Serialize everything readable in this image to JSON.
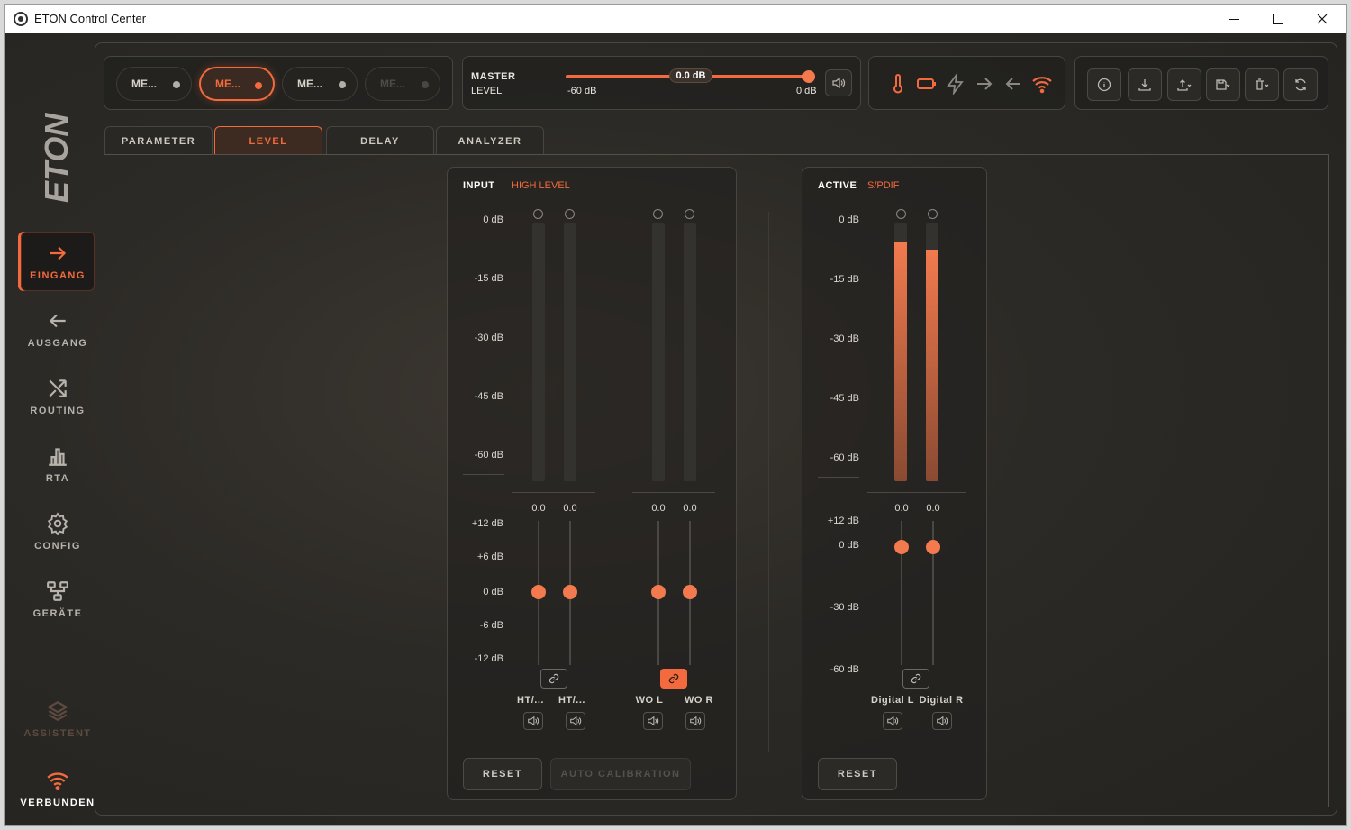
{
  "window": {
    "title": "ETON Control Center"
  },
  "sidebar": {
    "logo": "ETON",
    "items": [
      {
        "label": "EINGANG",
        "icon": "arrow-right-icon",
        "active": true
      },
      {
        "label": "AUSGANG",
        "icon": "arrow-left-icon"
      },
      {
        "label": "ROUTING",
        "icon": "shuffle-icon"
      },
      {
        "label": "RTA",
        "icon": "bar-chart-icon"
      },
      {
        "label": "CONFIG",
        "icon": "gear-icon"
      },
      {
        "label": "GERÄTE",
        "icon": "devices-icon"
      },
      {
        "label": "ASSISTENT",
        "icon": "layers-icon",
        "disabled": true
      },
      {
        "label": "VERBUNDEN",
        "icon": "wifi-icon"
      }
    ]
  },
  "presets": [
    {
      "label": "ME...",
      "state": "normal"
    },
    {
      "label": "ME...",
      "state": "active"
    },
    {
      "label": "ME...",
      "state": "normal"
    },
    {
      "label": "ME...",
      "state": "disabled"
    }
  ],
  "master": {
    "label_top": "MASTER",
    "label_bottom": "LEVEL",
    "value": "0.0 dB",
    "min_label": "-60 dB",
    "max_label": "0 dB",
    "level_fraction": 1.0
  },
  "status_icons": [
    "thermometer-icon",
    "battery-icon",
    "bolt-icon",
    "arrow-right-icon",
    "arrow-left-icon",
    "wifi-icon"
  ],
  "action_icons": [
    "info-icon",
    "download-icon",
    "upload-icon",
    "save-icon",
    "delete-icon",
    "refresh-icon"
  ],
  "tabs": [
    {
      "label": "PARAMETER"
    },
    {
      "label": "LEVEL",
      "active": true
    },
    {
      "label": "DELAY"
    },
    {
      "label": "ANALYZER"
    }
  ],
  "colors": {
    "accent": "#f26a3d",
    "background": "#262522",
    "panel_border": "#48443e"
  },
  "input": {
    "title": "INPUT",
    "subtitle": "HIGH LEVEL",
    "meter_scale": [
      "0 dB",
      "-15 dB",
      "-30 dB",
      "-45 dB",
      "-60 dB"
    ],
    "fader_scale": [
      "+12 dB",
      "+6 dB",
      "0 dB",
      "-6 dB",
      "-12 dB"
    ],
    "channels": [
      {
        "name": "HT/...",
        "value": "0.0",
        "meter_level": 0
      },
      {
        "name": "HT/...",
        "value": "0.0",
        "meter_level": 0
      },
      {
        "name": "WO L",
        "value": "0.0",
        "meter_level": 0
      },
      {
        "name": "WO R",
        "value": "0.0",
        "meter_level": 0
      }
    ],
    "links": [
      {
        "active": false
      },
      {
        "active": true
      }
    ],
    "reset_label": "RESET",
    "auto_calibration_label": "AUTO CALIBRATION"
  },
  "active": {
    "title": "ACTIVE",
    "subtitle": "S/PDIF",
    "meter_scale": [
      "0 dB",
      "-15 dB",
      "-30 dB",
      "-45 dB",
      "-60 dB"
    ],
    "fader_scale": [
      "+12 dB",
      "0 dB",
      "-30 dB",
      "-60 dB"
    ],
    "channels": [
      {
        "name": "Digital L",
        "value": "0.0",
        "meter_level": 0.93
      },
      {
        "name": "Digital R",
        "value": "0.0",
        "meter_level": 0.9
      }
    ],
    "reset_label": "RESET"
  }
}
